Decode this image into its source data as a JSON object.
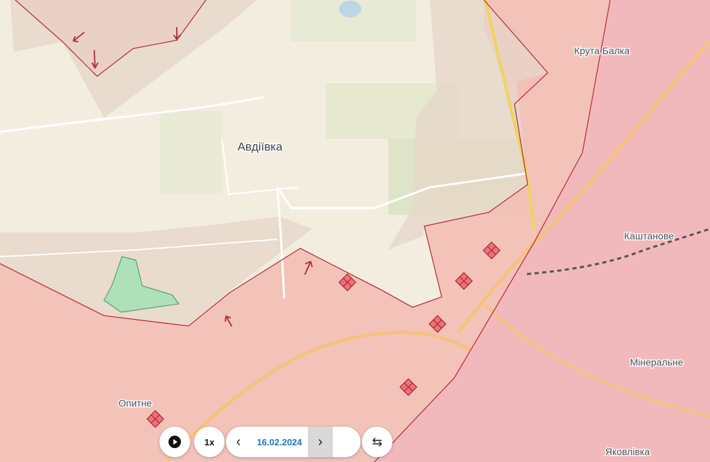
{
  "map": {
    "colors": {
      "background": "#f3ede0",
      "occupied": "#f3bfb6",
      "occupied_border": "#b5343c",
      "contested": "#e6d6c8",
      "ukraine_liberated": "#a8e2b9",
      "marker_fill": "#f0707a",
      "marker_stroke": "#a6252f"
    },
    "labels": {
      "avdiivka": "Авдіївка",
      "kruta_balka": "Крута Балка",
      "kashtanove": "Каштанове",
      "minerálne": "Мінеральне",
      "opytne": "Опитне",
      "yakovlivka": "Яковлівка"
    },
    "icons": {
      "attack": "attack-arrow-icon",
      "fighting": "fighting-diamond-icon"
    }
  },
  "timeline": {
    "play_icon": "play-icon",
    "speed_label": "1x",
    "prev_icon": "chevron-left-icon",
    "date": "16.02.2024",
    "next_icon": "chevron-right-icon",
    "swap_icon": "swap-arrows-icon"
  }
}
